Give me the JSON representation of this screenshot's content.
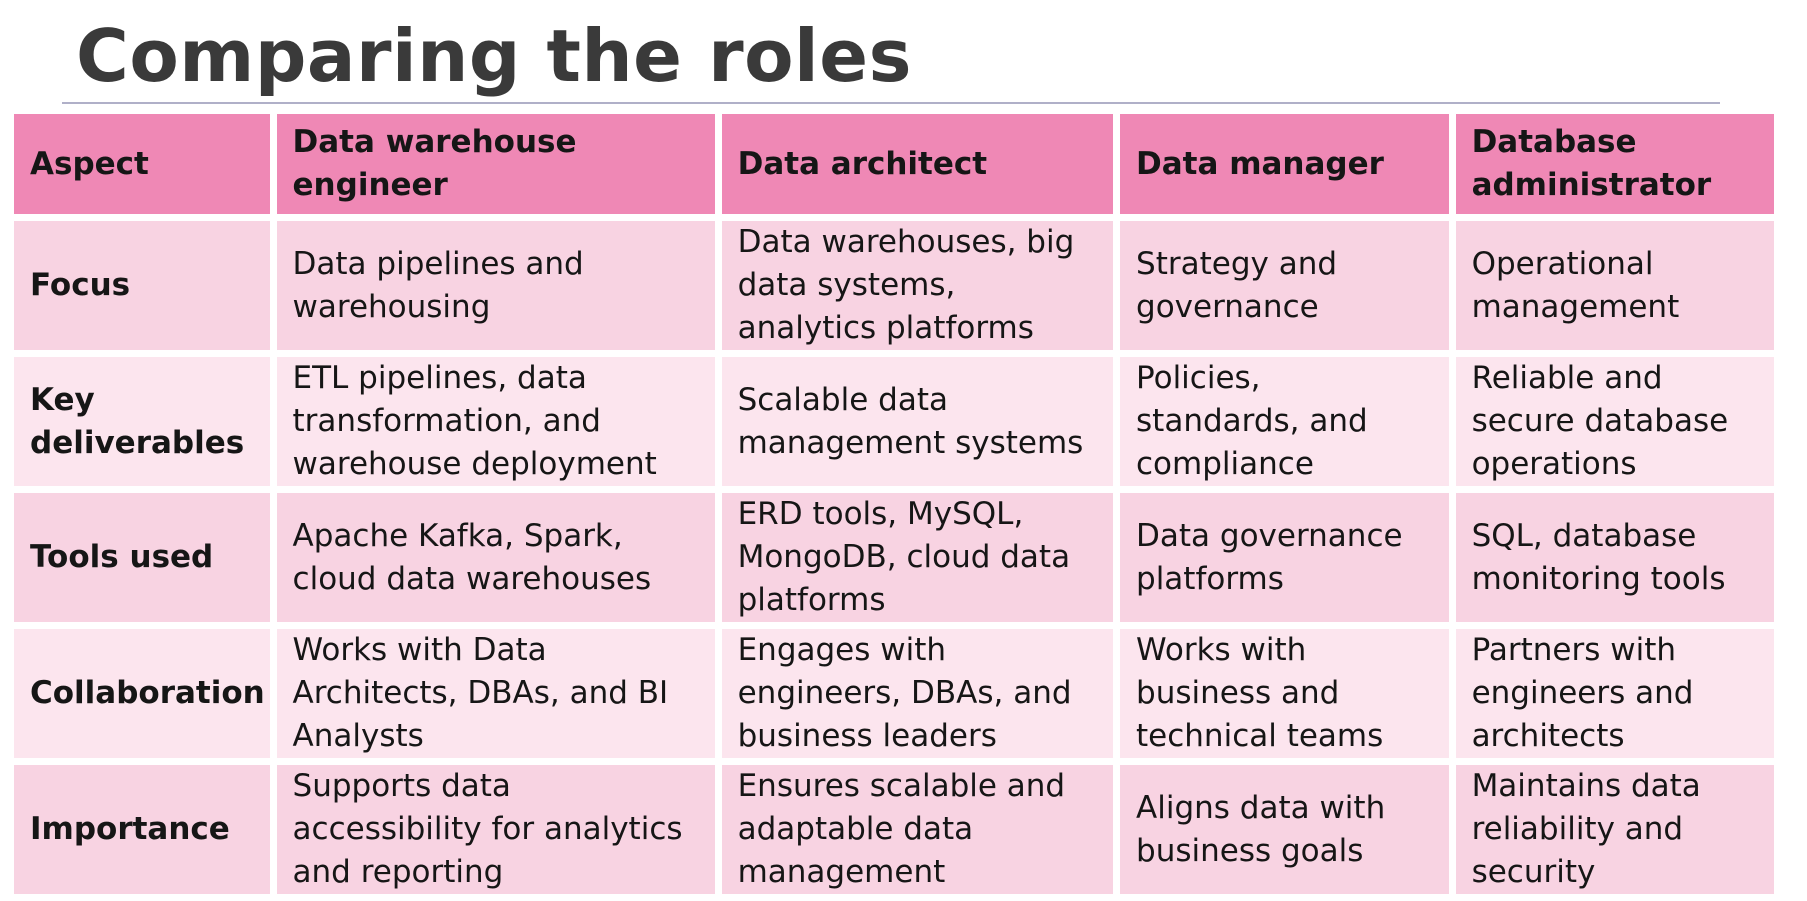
{
  "slide": {
    "title": "Comparing the roles"
  },
  "table": {
    "headers": [
      "Aspect",
      "Data warehouse engineer",
      "Data architect",
      "Data manager",
      "Database administrator"
    ],
    "rows": [
      {
        "aspect": "Focus",
        "cells": [
          "Data pipelines and warehousing",
          "Data warehouses, big data systems, analytics platforms",
          "Strategy and governance",
          "Operational management"
        ]
      },
      {
        "aspect": "Key deliverables",
        "cells": [
          "ETL pipelines, data transformation, and warehouse deployment",
          "Scalable data management systems",
          "Policies, standards, and compliance",
          "Reliable and secure database operations"
        ]
      },
      {
        "aspect": "Tools used",
        "cells": [
          "Apache Kafka, Spark, cloud data warehouses",
          "ERD tools, MySQL, MongoDB, cloud data platforms",
          "Data governance platforms",
          "SQL, database monitoring tools"
        ]
      },
      {
        "aspect": "Collaboration",
        "cells": [
          "Works with Data Architects, DBAs, and BI Analysts",
          "Engages with engineers, DBAs, and business leaders",
          "Works with business and technical teams",
          "Partners with engineers and architects"
        ]
      },
      {
        "aspect": "Importance",
        "cells": [
          "Supports data accessibility for analytics and reporting",
          "Ensures scalable and adaptable data management",
          "Aligns data with business goals",
          "Maintains data reliability and security"
        ]
      }
    ]
  },
  "colors": {
    "header_bg": "#ef88b5",
    "row_odd_bg": "#f8d3e2",
    "row_even_bg": "#fce5ee",
    "title_color": "#3a3a3a",
    "rule_color": "#b0b0c8"
  }
}
